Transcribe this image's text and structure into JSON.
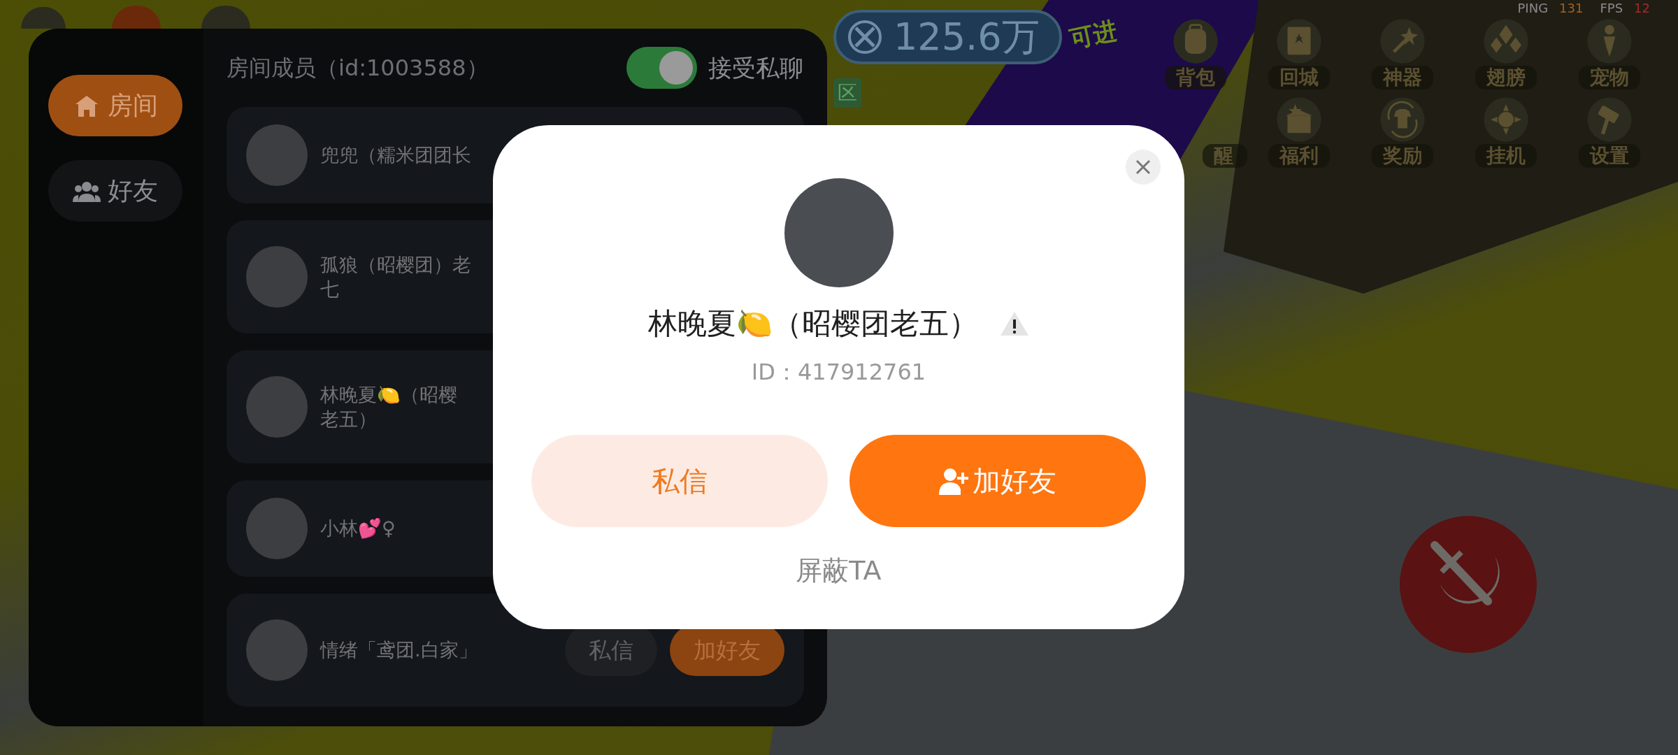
{
  "game_hud": {
    "coin_amount": "125.6万",
    "zone_tag": "区",
    "banner_text": "可进",
    "stats": [
      {
        "label": "PING",
        "value": "131",
        "color": "#a0621e"
      },
      {
        "label": "FPS",
        "value": "12",
        "color": "#a32a2a"
      }
    ],
    "menu": [
      {
        "label": "背包"
      },
      {
        "label": "回城"
      },
      {
        "label": "神器"
      },
      {
        "label": "翅膀"
      },
      {
        "label": "宠物"
      },
      {
        "label": "醒"
      },
      {
        "label": "福利"
      },
      {
        "label": "奖励"
      },
      {
        "label": "挂机"
      },
      {
        "label": "设置"
      }
    ]
  },
  "room_panel": {
    "nav": [
      {
        "label": "房间",
        "selected": true
      },
      {
        "label": "好友",
        "selected": false
      }
    ],
    "title": "房间成员（id:1003588）",
    "accept_private_chat": {
      "label": "接受私聊",
      "on": true
    },
    "members": [
      {
        "name_lines": [
          "兜兜（糯米团团长"
        ]
      },
      {
        "name_lines": [
          "孤狼（昭樱团）老",
          "七"
        ]
      },
      {
        "name_lines": [
          "林晚夏🍋（昭樱",
          "老五）"
        ]
      },
      {
        "name_lines": [
          "小林💕♀"
        ]
      },
      {
        "name_lines": [
          "情绪「鸢团.白家」"
        ],
        "buttons": [
          {
            "label": "私信",
            "kind": "secondary"
          },
          {
            "label": "加好友",
            "kind": "primary"
          }
        ]
      }
    ]
  },
  "profile_dialog": {
    "name": "林晚夏🍋（昭樱团老五）",
    "id_text": "ID：417912761",
    "buttons": [
      {
        "label": "私信",
        "kind": "secondary"
      },
      {
        "label": "加好友",
        "kind": "primary"
      }
    ],
    "block_link": "屏蔽TA"
  }
}
